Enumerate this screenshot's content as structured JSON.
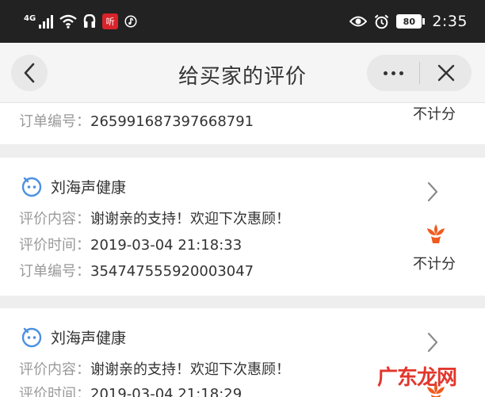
{
  "status_bar": {
    "network": "4G",
    "app_badge": "听",
    "battery": "80",
    "time": "2:35"
  },
  "nav": {
    "title": "给买家的评价"
  },
  "reviews": [
    {
      "order_label": "订单编号：",
      "order_no": "265991687397668791",
      "score": "不计分"
    },
    {
      "shop": "刘海声健康",
      "content_label": "评价内容：",
      "content": "谢谢亲的支持！欢迎下次惠顾！",
      "time_label": "评价时间：",
      "time": "2019-03-04 21:18:33",
      "order_label": "订单编号：",
      "order_no": "354747555920003047",
      "score": "不计分"
    },
    {
      "shop": "刘海声健康",
      "content_label": "评价内容：",
      "content": "谢谢亲的支持！欢迎下次惠顾！",
      "time_label": "评价时间：",
      "time": "2019-03-04 21:18:29"
    }
  ],
  "watermark": "广东龙网",
  "colors": {
    "status_bar_bg": "#222222",
    "nav_bg": "#f5f5f5",
    "page_bg": "#eeeeee",
    "shop_icon": "#4a90e2",
    "flower": "#f05a1e",
    "watermark": "#e3362c"
  }
}
